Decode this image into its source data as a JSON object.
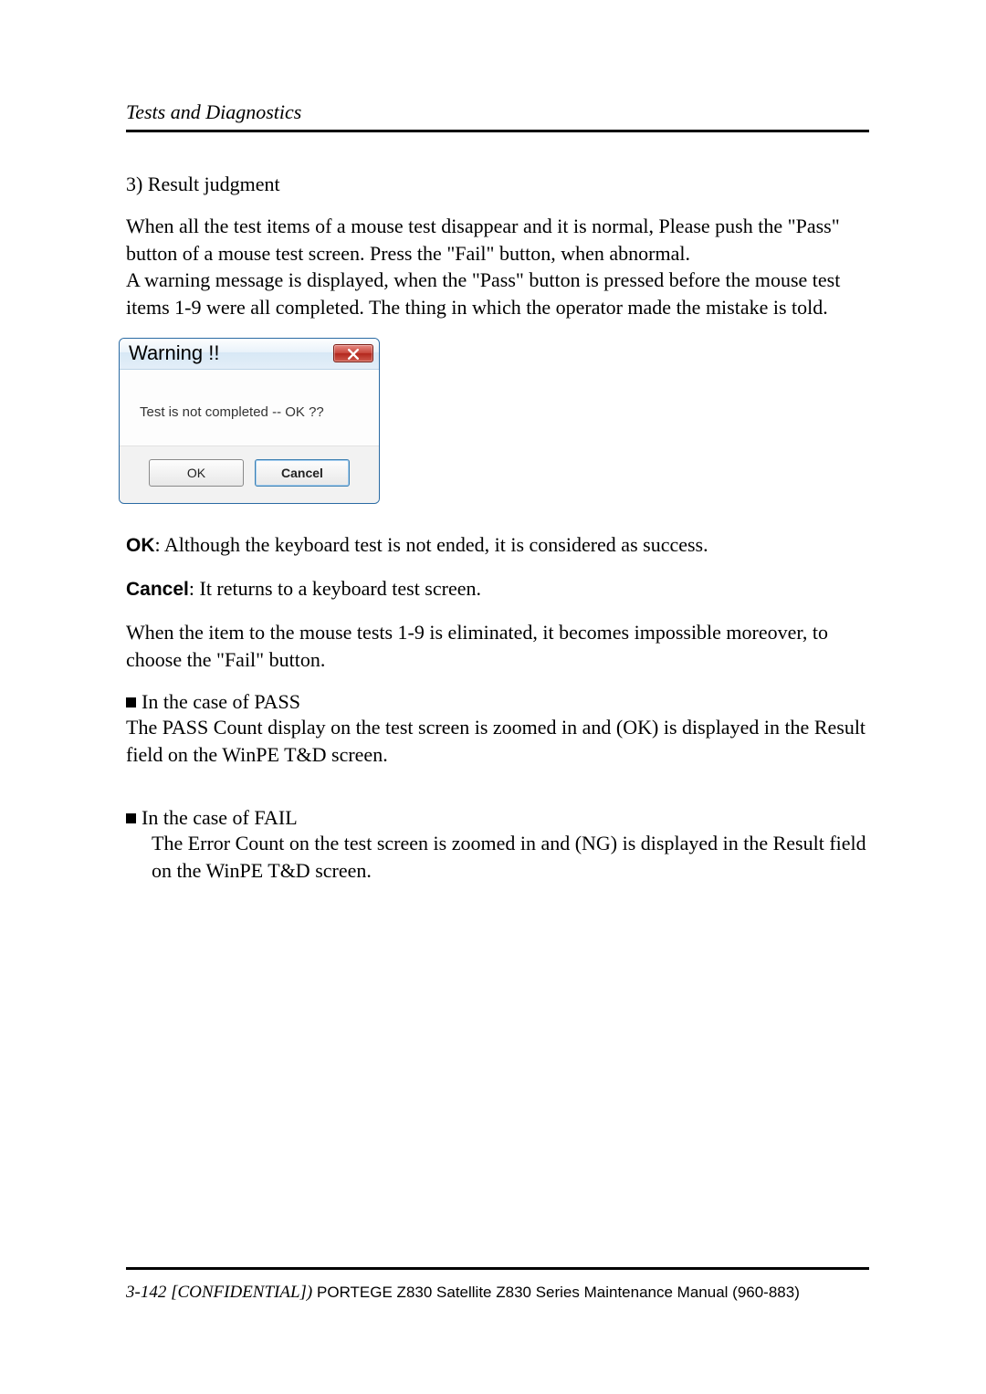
{
  "header": {
    "title": "Tests and Diagnostics"
  },
  "body": {
    "s1": "3) Result judgment",
    "p1": "When all the test items of a mouse test disappear and it is normal, Please push the \"Pass\" button of a mouse test screen. Press the \"Fail\" button, when abnormal.",
    "p2": "A warning message is displayed, when the \"Pass\" button is pressed before the mouse test items 1-9 were all completed. The thing in which the operator made the mistake is told.",
    "ok_label": "OK",
    "ok_desc": ": Although the keyboard test is not ended, it is considered as success.",
    "cancel_label": "Cancel",
    "cancel_desc": ": It returns to a keyboard test screen.",
    "p3": "When the item to the mouse tests 1-9 is eliminated, it becomes impossible moreover, to choose the \"Fail\" button.",
    "pass_h": "In the case of PASS",
    "pass_p": "The PASS Count display on the test screen is zoomed in and (OK) is displayed in the Result field on the WinPE T&D screen.",
    "fail_h": "In the case of FAIL",
    "fail_p": "The Error Count on the test screen is zoomed in and (NG) is displayed in the Result field on the WinPE T&D screen."
  },
  "dialog": {
    "title": "Warning !!",
    "message": "Test is not completed -- OK ??",
    "ok": "OK",
    "cancel": "Cancel"
  },
  "footer": {
    "left_italic": "3-142 [CONFIDENTIAL]) ",
    "rest": "PORTEGE Z830 Satellite Z830 Series Maintenance Manual (960-883)"
  }
}
